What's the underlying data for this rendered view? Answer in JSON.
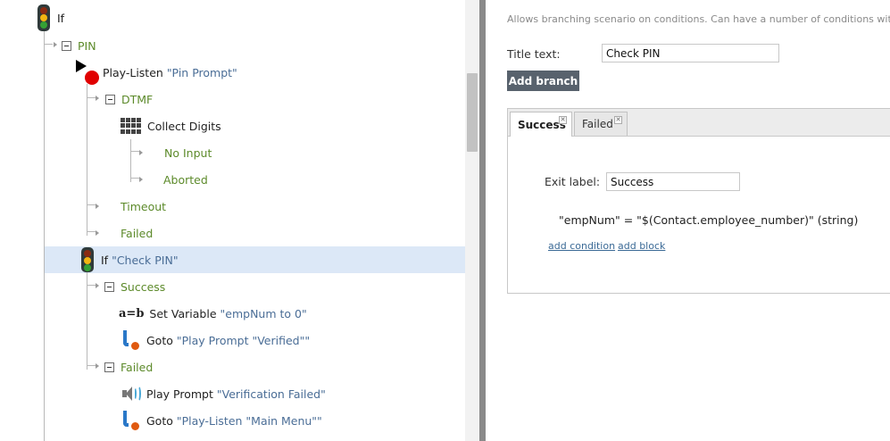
{
  "tree": {
    "root": {
      "label": "If"
    },
    "items": [
      {
        "kind": "branch",
        "label": "PIN"
      },
      {
        "kind": "node",
        "name": "Play-Listen",
        "arg": "\"Pin Prompt\""
      },
      {
        "kind": "branch",
        "label": "DTMF"
      },
      {
        "kind": "node",
        "name": "Collect Digits"
      },
      {
        "kind": "branch",
        "label": "No Input"
      },
      {
        "kind": "branch",
        "label": "Aborted"
      },
      {
        "kind": "branch",
        "label": "Timeout"
      },
      {
        "kind": "branch",
        "label": "Failed"
      },
      {
        "kind": "node",
        "name": "If",
        "arg": "\"Check PIN\"",
        "selected": true
      },
      {
        "kind": "branch",
        "label": "Success"
      },
      {
        "kind": "node",
        "name": "Set Variable",
        "arg": "\"empNum to 0\""
      },
      {
        "kind": "node",
        "name": "Goto",
        "arg": "\"Play Prompt \"Verified\"\""
      },
      {
        "kind": "branch",
        "label": "Failed"
      },
      {
        "kind": "node",
        "name": "Play Prompt",
        "arg": "\"Verification Failed\""
      },
      {
        "kind": "node",
        "name": "Goto",
        "arg": "\"Play-Listen \"Main Menu\"\""
      }
    ]
  },
  "icons": {
    "if": "traffic-light-icon",
    "play_listen": "play-listen-icon",
    "collect_digits": "keypad-icon",
    "set_variable": "a-equals-b-icon",
    "goto": "goto-arrow-icon",
    "play_prompt": "speaker-icon"
  },
  "props": {
    "description": "Allows branching scenario on conditions. Can have a number of conditions with ass",
    "title_label": "Title text:",
    "title_value": "Check PIN",
    "add_branch_label": "Add branch",
    "tabs": [
      {
        "label": "Success",
        "active": true
      },
      {
        "label": "Failed",
        "active": false
      }
    ],
    "exit_label": "Exit label:",
    "exit_value": "Success",
    "condition": "\"empNum\" = \"$(Contact.employee_number)\" (string)",
    "add_condition": "add condition",
    "add_block": "add block"
  },
  "colors": {
    "branch": "#5c8a2a",
    "quoted": "#4a6d96",
    "selection": "#dce8f7",
    "button": "#58626d"
  }
}
